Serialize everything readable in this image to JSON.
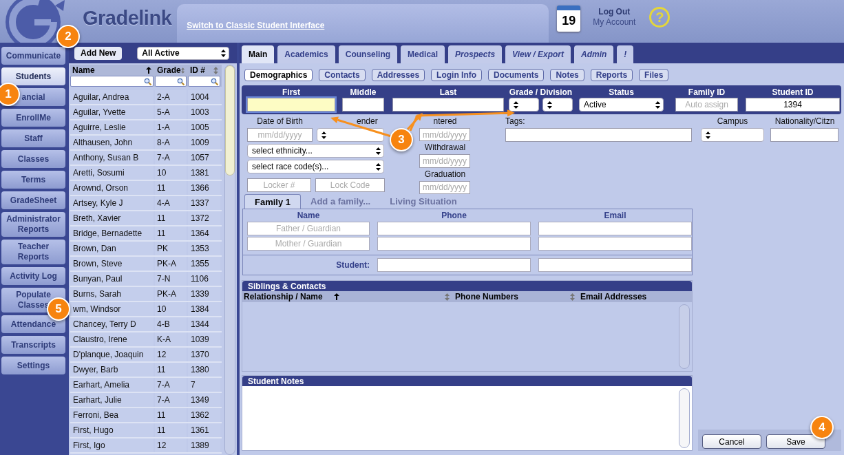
{
  "header": {
    "app_name": "Gradelink",
    "classic_link": "Switch to Classic Student Interface",
    "calendar_day": "19",
    "logout": "Log Out",
    "account": "My Account",
    "help_symbol": "?"
  },
  "nav": [
    {
      "label": "Communicate",
      "selected": false
    },
    {
      "label": "Students",
      "selected": true
    },
    {
      "label": "ancial",
      "selected": false
    },
    {
      "label": "EnrollMe",
      "selected": false
    },
    {
      "label": "Staff",
      "selected": false
    },
    {
      "label": "Classes",
      "selected": false
    },
    {
      "label": "Terms",
      "selected": false
    },
    {
      "label": "GradeSheet",
      "selected": false
    },
    {
      "label": "Administrator Reports",
      "selected": false
    },
    {
      "label": "Teacher Reports",
      "selected": false
    },
    {
      "label": "Activity Log",
      "selected": false
    },
    {
      "label": "Populate Classes",
      "selected": false
    },
    {
      "label": "Attendance",
      "selected": false
    },
    {
      "label": "Transcripts",
      "selected": false
    },
    {
      "label": "Settings",
      "selected": false
    }
  ],
  "student_list": {
    "add_button": "Add New",
    "filter": "All Active",
    "columns": [
      {
        "label": "Name",
        "sorted": true
      },
      {
        "label": "Grade",
        "sorted": false
      },
      {
        "label": "ID #",
        "sorted": false
      }
    ],
    "rows": [
      {
        "name": "Aguilar, Andrea",
        "grade": "2-A",
        "id": "1004"
      },
      {
        "name": "Aguilar, Yvette",
        "grade": "5-A",
        "id": "1003"
      },
      {
        "name": "Aguirre, Leslie",
        "grade": "1-A",
        "id": "1005"
      },
      {
        "name": "Althausen, John",
        "grade": "8-A",
        "id": "1009"
      },
      {
        "name": "Anthony, Susan B",
        "grade": "7-A",
        "id": "1057"
      },
      {
        "name": "Aretti, Sosumi",
        "grade": "10",
        "id": "1381"
      },
      {
        "name": "Arownd, Orson",
        "grade": "11",
        "id": "1366"
      },
      {
        "name": "Artsey, Kyle J",
        "grade": "4-A",
        "id": "1337"
      },
      {
        "name": "Breth, Xavier",
        "grade": "11",
        "id": "1372"
      },
      {
        "name": "Bridge, Bernadette",
        "grade": "11",
        "id": "1364"
      },
      {
        "name": "Brown, Dan",
        "grade": "PK",
        "id": "1353"
      },
      {
        "name": "Brown, Steve",
        "grade": "PK-A",
        "id": "1355"
      },
      {
        "name": "Bunyan, Paul",
        "grade": "7-N",
        "id": "1106"
      },
      {
        "name": "Burns, Sarah",
        "grade": "PK-A",
        "id": "1339"
      },
      {
        "name": "wm, Windsor",
        "grade": "10",
        "id": "1384"
      },
      {
        "name": "Chancey, Terry D",
        "grade": "4-B",
        "id": "1344"
      },
      {
        "name": "Claustro, Irene",
        "grade": "K-A",
        "id": "1039"
      },
      {
        "name": "D'planque, Joaquin",
        "grade": "12",
        "id": "1370"
      },
      {
        "name": "Dwyer, Barb",
        "grade": "11",
        "id": "1380"
      },
      {
        "name": "Earhart, Amelia",
        "grade": "7-A",
        "id": "7"
      },
      {
        "name": "Earhart, Julie",
        "grade": "7-A",
        "id": "1349"
      },
      {
        "name": "Ferroni, Bea",
        "grade": "11",
        "id": "1362"
      },
      {
        "name": "First, Hugo",
        "grade": "11",
        "id": "1361"
      },
      {
        "name": "First, Igo",
        "grade": "12",
        "id": "1389"
      }
    ]
  },
  "tabs": [
    {
      "label": "Main",
      "selected": true,
      "italic": false
    },
    {
      "label": "Academics",
      "selected": false,
      "italic": false
    },
    {
      "label": "Counseling",
      "selected": false,
      "italic": false
    },
    {
      "label": "Medical",
      "selected": false,
      "italic": false
    },
    {
      "label": "Prospects",
      "selected": false,
      "italic": true
    },
    {
      "label": "View / Export",
      "selected": false,
      "italic": true
    },
    {
      "label": "Admin",
      "selected": false,
      "italic": true
    },
    {
      "label": "!",
      "selected": false,
      "italic": true
    }
  ],
  "subtabs": [
    {
      "label": "Demographics",
      "selected": true
    },
    {
      "label": "Contacts",
      "selected": false
    },
    {
      "label": "Addresses",
      "selected": false
    },
    {
      "label": "Login Info",
      "selected": false
    },
    {
      "label": "Documents",
      "selected": false
    },
    {
      "label": "Notes",
      "selected": false
    },
    {
      "label": "Reports",
      "selected": false
    },
    {
      "label": "Files",
      "selected": false
    }
  ],
  "id_fields": [
    {
      "label": "First",
      "inputs": [
        {
          "kind": "text",
          "focused": true
        }
      ]
    },
    {
      "label": "Middle",
      "inputs": [
        {
          "kind": "text",
          "focused": false
        }
      ]
    },
    {
      "label": "Last",
      "inputs": [
        {
          "kind": "text",
          "focused": false
        }
      ]
    },
    {
      "label": "Grade / Division",
      "inputs": [
        {
          "kind": "select"
        },
        {
          "kind": "select"
        }
      ]
    },
    {
      "label": "Status",
      "inputs": [
        {
          "kind": "select",
          "value": "Active"
        }
      ]
    },
    {
      "label": "Family ID",
      "inputs": [
        {
          "kind": "text",
          "focused": false,
          "placeholder": "Auto assign"
        }
      ]
    },
    {
      "label": "Student ID",
      "inputs": [
        {
          "kind": "text",
          "focused": false,
          "value": "1394"
        }
      ]
    }
  ],
  "demographics": {
    "dob_label": "Date of Birth",
    "dob_placeholder": "mm/dd/yyyy",
    "gender_label": "ender",
    "ethnicity": "select ethnicity...",
    "race": "select race code(s)...",
    "locker_placeholder": "Locker #",
    "lock_code_placeholder": "Lock Code",
    "dates": [
      {
        "label": "ntered",
        "placeholder": "mm/dd/yyyy"
      },
      {
        "label": "Withdrawal",
        "placeholder": "mm/dd/yyyy"
      },
      {
        "label": "Graduation",
        "placeholder": "mm/dd/yyyy"
      }
    ],
    "tags_label": "Tags:",
    "campus_label": "Campus",
    "nationality_label": "Nationality/Citzn"
  },
  "family": {
    "tabs": [
      {
        "label": "Family 1",
        "selected": true
      },
      {
        "label": "Add a family...",
        "selected": false
      },
      {
        "label": "Living Situation",
        "selected": false
      }
    ],
    "columns": [
      "Name",
      "Phone",
      "Email"
    ],
    "guardian_placeholders": [
      "Father / Guardian",
      "Mother / Guardian"
    ],
    "student_label": "Student:"
  },
  "siblings": {
    "title": "Siblings & Contacts",
    "columns": [
      {
        "label": "Relationship / Name",
        "sorted": true
      },
      {
        "sorted": false
      },
      {
        "label": "Phone Numbers",
        "sorted": false
      },
      {
        "label": "Email Addresses"
      }
    ]
  },
  "notes": {
    "title": "Student Notes"
  },
  "buttons": [
    "Cancel",
    "Save"
  ],
  "callouts": [
    "1",
    "2",
    "3",
    "4",
    "5"
  ]
}
